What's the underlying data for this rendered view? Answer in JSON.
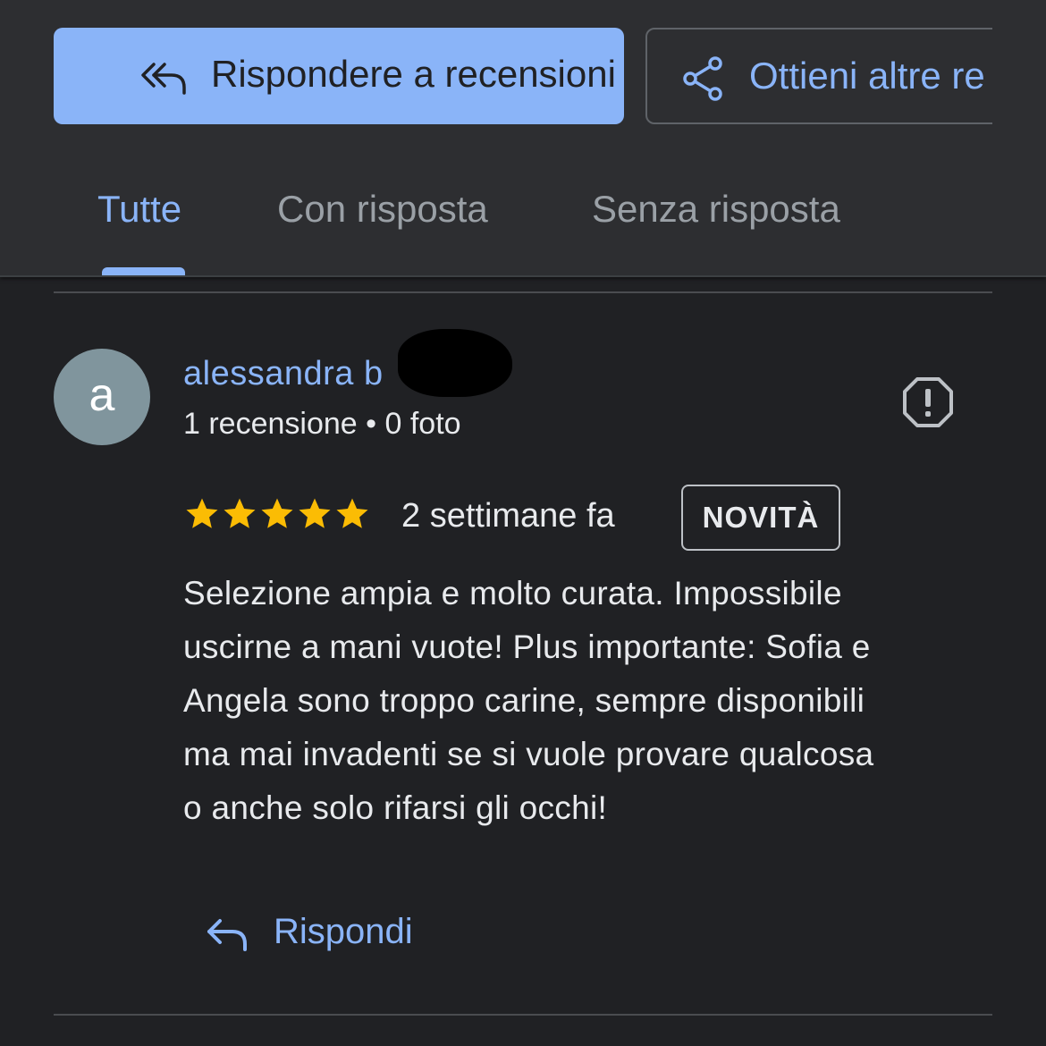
{
  "toolbar": {
    "reply_reviews_label": "Rispondere a recensioni",
    "reply_reviews_icon": "reply-all-icon",
    "get_more_label": "Ottieni altre re",
    "get_more_icon": "share-icon",
    "accent_color": "#8ab4f8"
  },
  "tabs": [
    {
      "label": "Tutte",
      "selected": true
    },
    {
      "label": "Con risposta",
      "selected": false
    },
    {
      "label": "Senza risposta",
      "selected": false
    }
  ],
  "review": {
    "avatar_initial": "a",
    "author": "alessandra b",
    "meta": "1 recensione • 0 foto",
    "flag_icon": "report-icon",
    "rating": 5,
    "rating_max": 5,
    "time": "2 settimane fa",
    "badge": "NOVITÀ",
    "text_lines": [
      "Selezione ampia e molto curata. Impossibile",
      "uscirne a mani vuote! Plus importante: Sofia e",
      "Angela sono troppo carine, sempre disponibili",
      "ma mai invadenti se si vuole provare qualcosa",
      "o anche solo rifarsi gli occhi!"
    ],
    "reply_label": "Rispondi",
    "reply_icon": "reply-icon"
  },
  "colors": {
    "background": "#202124",
    "header": "#2d2e31",
    "star": "#fbbc04",
    "avatar": "#80959d"
  }
}
